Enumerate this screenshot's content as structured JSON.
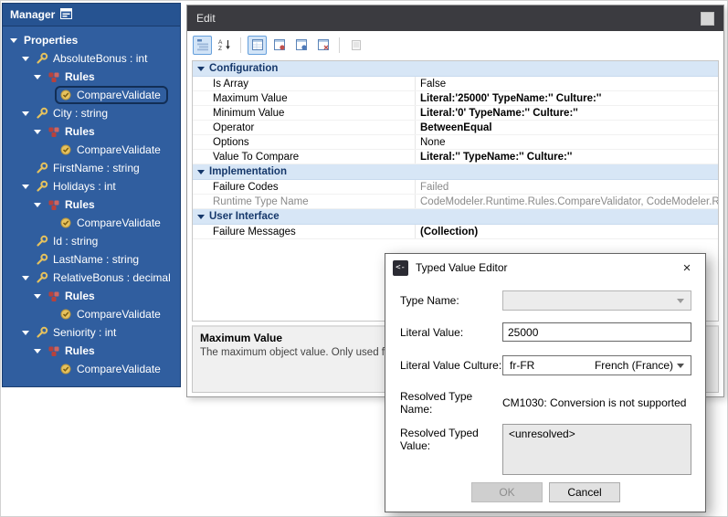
{
  "glyphs": {
    "close": "×",
    "dialog_icon": "<-"
  },
  "tree": {
    "title": "Manager",
    "items": [
      {
        "label": "Properties",
        "level": 0,
        "icon": "none",
        "expander": true,
        "bold": true
      },
      {
        "label": "AbsoluteBonus : int",
        "level": 1,
        "icon": "property",
        "expander": true
      },
      {
        "label": "Rules",
        "level": 2,
        "icon": "rules",
        "expander": true,
        "bold": true
      },
      {
        "label": "CompareValidate",
        "level": 3,
        "icon": "validator",
        "selected": true
      },
      {
        "label": "City : string",
        "level": 1,
        "icon": "property",
        "expander": true
      },
      {
        "label": "Rules",
        "level": 2,
        "icon": "rules",
        "expander": true,
        "bold": true
      },
      {
        "label": "CompareValidate",
        "level": 3,
        "icon": "validator"
      },
      {
        "label": "FirstName : string",
        "level": 1,
        "icon": "property"
      },
      {
        "label": "Holidays : int",
        "level": 1,
        "icon": "property",
        "expander": true
      },
      {
        "label": "Rules",
        "level": 2,
        "icon": "rules",
        "expander": true,
        "bold": true
      },
      {
        "label": "CompareValidate",
        "level": 3,
        "icon": "validator"
      },
      {
        "label": "Id : string",
        "level": 1,
        "icon": "property"
      },
      {
        "label": "LastName : string",
        "level": 1,
        "icon": "property"
      },
      {
        "label": "RelativeBonus : decimal",
        "level": 1,
        "icon": "property",
        "expander": true
      },
      {
        "label": "Rules",
        "level": 2,
        "icon": "rules",
        "expander": true,
        "bold": true
      },
      {
        "label": "CompareValidate",
        "level": 3,
        "icon": "validator"
      },
      {
        "label": "Seniority : int",
        "level": 1,
        "icon": "property",
        "expander": true
      },
      {
        "label": "Rules",
        "level": 2,
        "icon": "rules",
        "expander": true,
        "bold": true
      },
      {
        "label": "CompareValidate",
        "level": 3,
        "icon": "validator"
      }
    ]
  },
  "edit": {
    "title": "Edit",
    "description": {
      "title": "Maximum Value",
      "text": "The maximum object value. Only used for bin"
    }
  },
  "toolbar": {
    "icons": [
      {
        "name": "categorized",
        "icon": "categorized",
        "active": true
      },
      {
        "name": "sort-alphabetical",
        "icon": "alphabetical"
      },
      {
        "name": "sep"
      },
      {
        "name": "grid-view-a",
        "icon": "page",
        "active": true
      },
      {
        "name": "grid-view-b",
        "icon": "page2"
      },
      {
        "name": "grid-view-c",
        "icon": "page3"
      },
      {
        "name": "grid-view-d",
        "icon": "page4"
      },
      {
        "name": "sep"
      },
      {
        "name": "property-pages",
        "icon": "pages",
        "disabled": true
      }
    ]
  },
  "grid": {
    "categories": [
      {
        "name": "Configuration",
        "rows": [
          {
            "name": "Is Array",
            "value": "False"
          },
          {
            "name": "Maximum Value",
            "value": "Literal:'25000' TypeName:'' Culture:''",
            "bold": true
          },
          {
            "name": "Minimum Value",
            "value": "Literal:'0' TypeName:'' Culture:''",
            "bold": true
          },
          {
            "name": "Operator",
            "value": "BetweenEqual",
            "bold": true
          },
          {
            "name": "Options",
            "value": "None"
          },
          {
            "name": "Value To Compare",
            "value": "Literal:'' TypeName:'' Culture:''",
            "bold": true
          }
        ]
      },
      {
        "name": "Implementation",
        "rows": [
          {
            "name": "Failure Codes",
            "value": "Failed",
            "muted": true
          },
          {
            "name": "Runtime Type Name",
            "value": "CodeModeler.Runtime.Rules.CompareValidator, CodeModeler.Runtime",
            "muted": true,
            "name_muted": true
          }
        ]
      },
      {
        "name": "User Interface",
        "rows": [
          {
            "name": "Failure Messages",
            "value": "(Collection)",
            "bold": true
          }
        ]
      }
    ]
  },
  "dialog": {
    "title": "Typed Value Editor",
    "type_name": {
      "label": "Type Name:",
      "value": ""
    },
    "literal_value": {
      "label": "Literal Value:",
      "value": "25000"
    },
    "culture": {
      "label": "Literal Value Culture:",
      "code": "fr-FR",
      "display": "French (France)"
    },
    "resolved_type": {
      "label": "Resolved Type Name:",
      "value": "CM1030: Conversion is not supported"
    },
    "resolved_value": {
      "label": "Resolved Typed Value:",
      "value": "<unresolved>"
    },
    "ok_label": "OK",
    "cancel_label": "Cancel"
  }
}
